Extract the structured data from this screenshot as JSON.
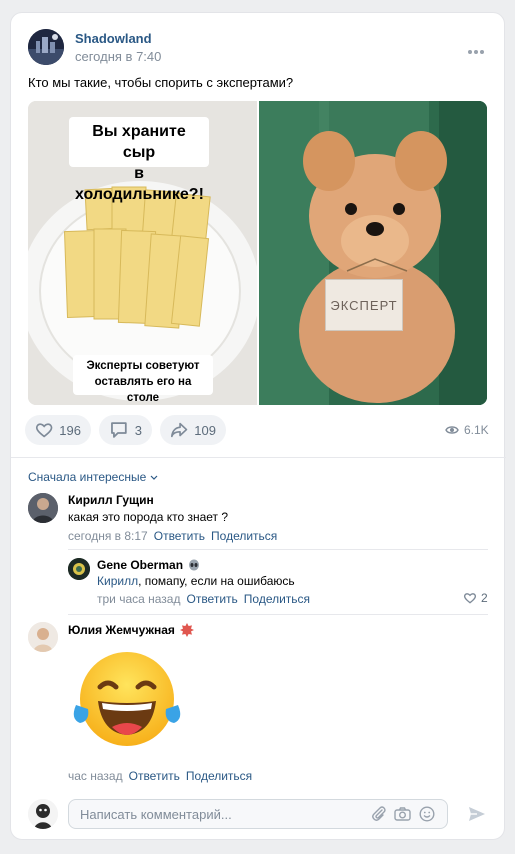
{
  "post": {
    "author": "Shadowland",
    "time": "сегодня в 7:40",
    "text": "Кто мы такие, чтобы спорить с экспертами?",
    "photo_left": {
      "top_caption": "Вы храните сыр\nв холодильнике?!",
      "bottom_caption": "Эксперты советуют\nоставлять его на столе"
    },
    "photo_right": {
      "sign_text": "ЭКСПЕРТ"
    },
    "likes": "196",
    "comments": "3",
    "shares": "109",
    "views": "6.1K"
  },
  "comments_sort": "Сначала интересные",
  "comments": [
    {
      "author": "Кирилл Гущин",
      "text": "какая это порода кто знает ?",
      "time": "сегодня в 8:17",
      "reply_label": "Ответить",
      "share_label": "Поделиться"
    },
    {
      "author": "Gene Oberman",
      "mention": "Кирилл",
      "text": ", помапу, если на ошибаюсь",
      "time": "три часа назад",
      "reply_label": "Ответить",
      "share_label": "Поделиться",
      "likes": "2"
    },
    {
      "author": "Юлия Жемчужная",
      "time": "час назад",
      "reply_label": "Ответить",
      "share_label": "Поделиться"
    }
  ],
  "comment_input": {
    "placeholder": "Написать комментарий..."
  },
  "colors": {
    "link": "#2a5885",
    "muted": "#818c99",
    "background": "#edeef0"
  }
}
